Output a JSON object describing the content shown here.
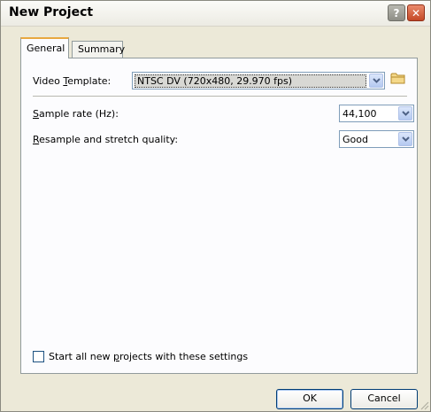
{
  "window": {
    "title": "New Project"
  },
  "titlebar": {
    "help_glyph": "?",
    "close_glyph": "✕"
  },
  "tabs": [
    {
      "label": "General",
      "active": true
    },
    {
      "label": "Summary",
      "active": false
    }
  ],
  "general": {
    "video_template": {
      "label_pre": "Video ",
      "label_key": "T",
      "label_post": "emplate:",
      "value": "NTSC DV (720x480, 29.970 fps)"
    },
    "sample_rate": {
      "label_key": "S",
      "label_post": "ample rate (Hz):",
      "value": "44,100"
    },
    "resample": {
      "label_key": "R",
      "label_post": "esample and stretch quality:",
      "value": "Good"
    },
    "start_checkbox": {
      "label_pre": "Start all new ",
      "label_key": "p",
      "label_post": "rojects with these settings",
      "checked": false
    }
  },
  "footer": {
    "ok_label": "OK",
    "cancel_label": "Cancel"
  },
  "icons": {
    "help": "help-icon",
    "close": "close-icon",
    "folder": "folder-icon",
    "dropdown": "chevron-down-icon"
  },
  "colors": {
    "panel_bg": "#fcfcfe",
    "dialog_bg": "#ece9d8",
    "close_red": "#c44826",
    "tab_accent": "#e8a840"
  }
}
